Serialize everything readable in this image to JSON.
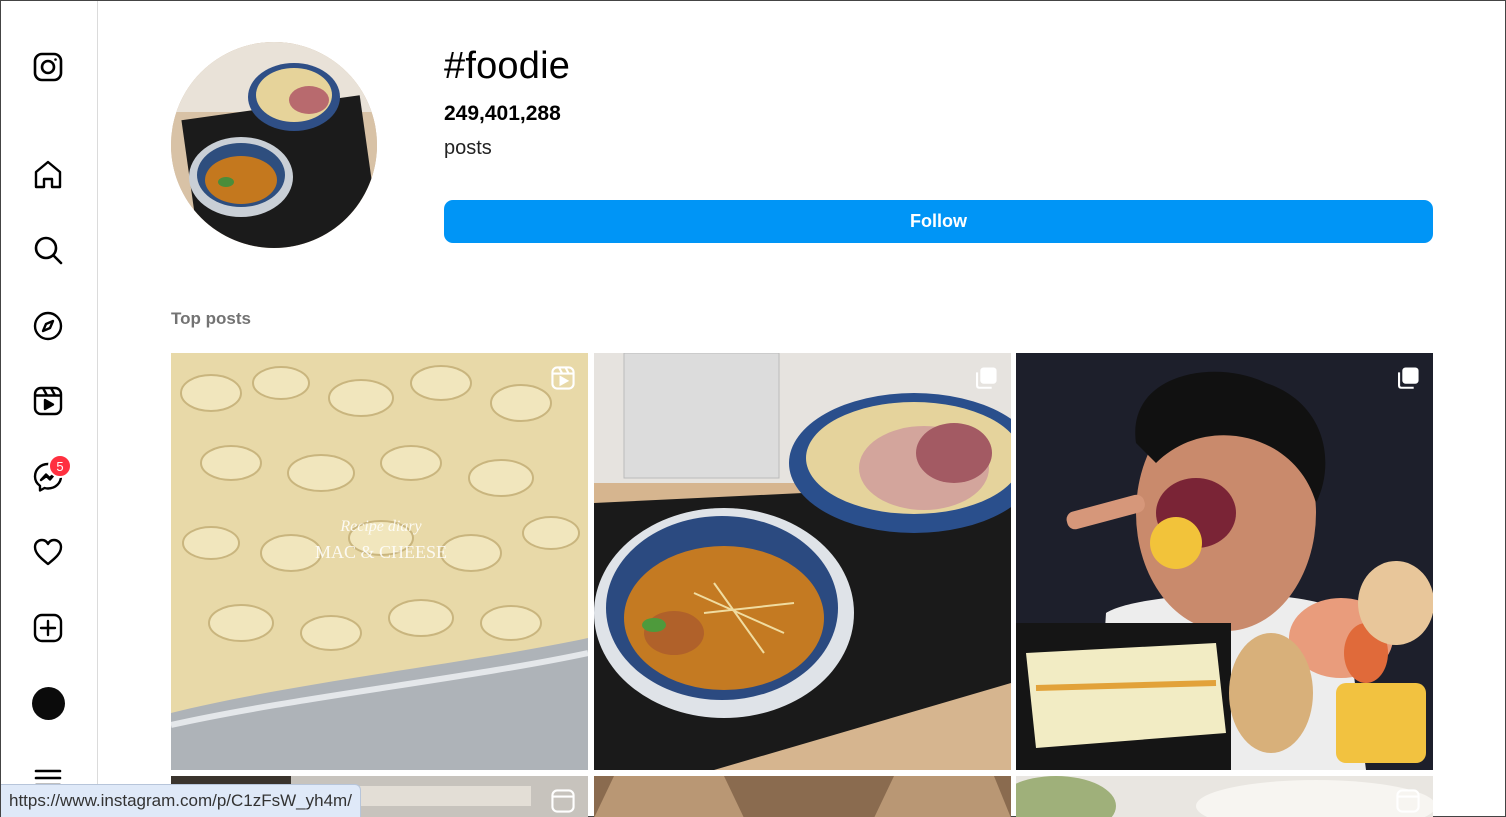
{
  "sidebar": {
    "items": [
      {
        "name": "instagram-logo-icon"
      },
      {
        "name": "home-icon"
      },
      {
        "name": "search-icon"
      },
      {
        "name": "explore-icon"
      },
      {
        "name": "reels-icon"
      },
      {
        "name": "messenger-icon"
      },
      {
        "name": "heart-icon"
      },
      {
        "name": "create-icon"
      },
      {
        "name": "profile-avatar"
      },
      {
        "name": "menu-icon"
      }
    ],
    "messages_badge": "5"
  },
  "header": {
    "hashtag": "#foodie",
    "post_count": "249,401,288",
    "post_label": "posts",
    "follow_label": "Follow"
  },
  "top_posts": {
    "title": "Top posts",
    "posts": [
      {
        "subject": "mac and cheese",
        "type_icon": "reels-icon",
        "overlay_text_1": "Recipe diary",
        "overlay_text_2": "MAC & CHEESE"
      },
      {
        "subject": "tsukemen ramen",
        "type_icon": "carousel-icon"
      },
      {
        "subject": "mukbang eating",
        "type_icon": "carousel-icon"
      },
      {
        "subject": "partial post",
        "type_icon": "reels-icon"
      },
      {
        "subject": "partial post",
        "type_icon": ""
      },
      {
        "subject": "partial post",
        "type_icon": "reels-icon"
      }
    ]
  },
  "status_bar": {
    "url": "https://www.instagram.com/p/C1zFsW_yh4m/"
  },
  "colors": {
    "accent": "#0095f6",
    "badge": "#ff3040",
    "muted_text": "#737373"
  }
}
